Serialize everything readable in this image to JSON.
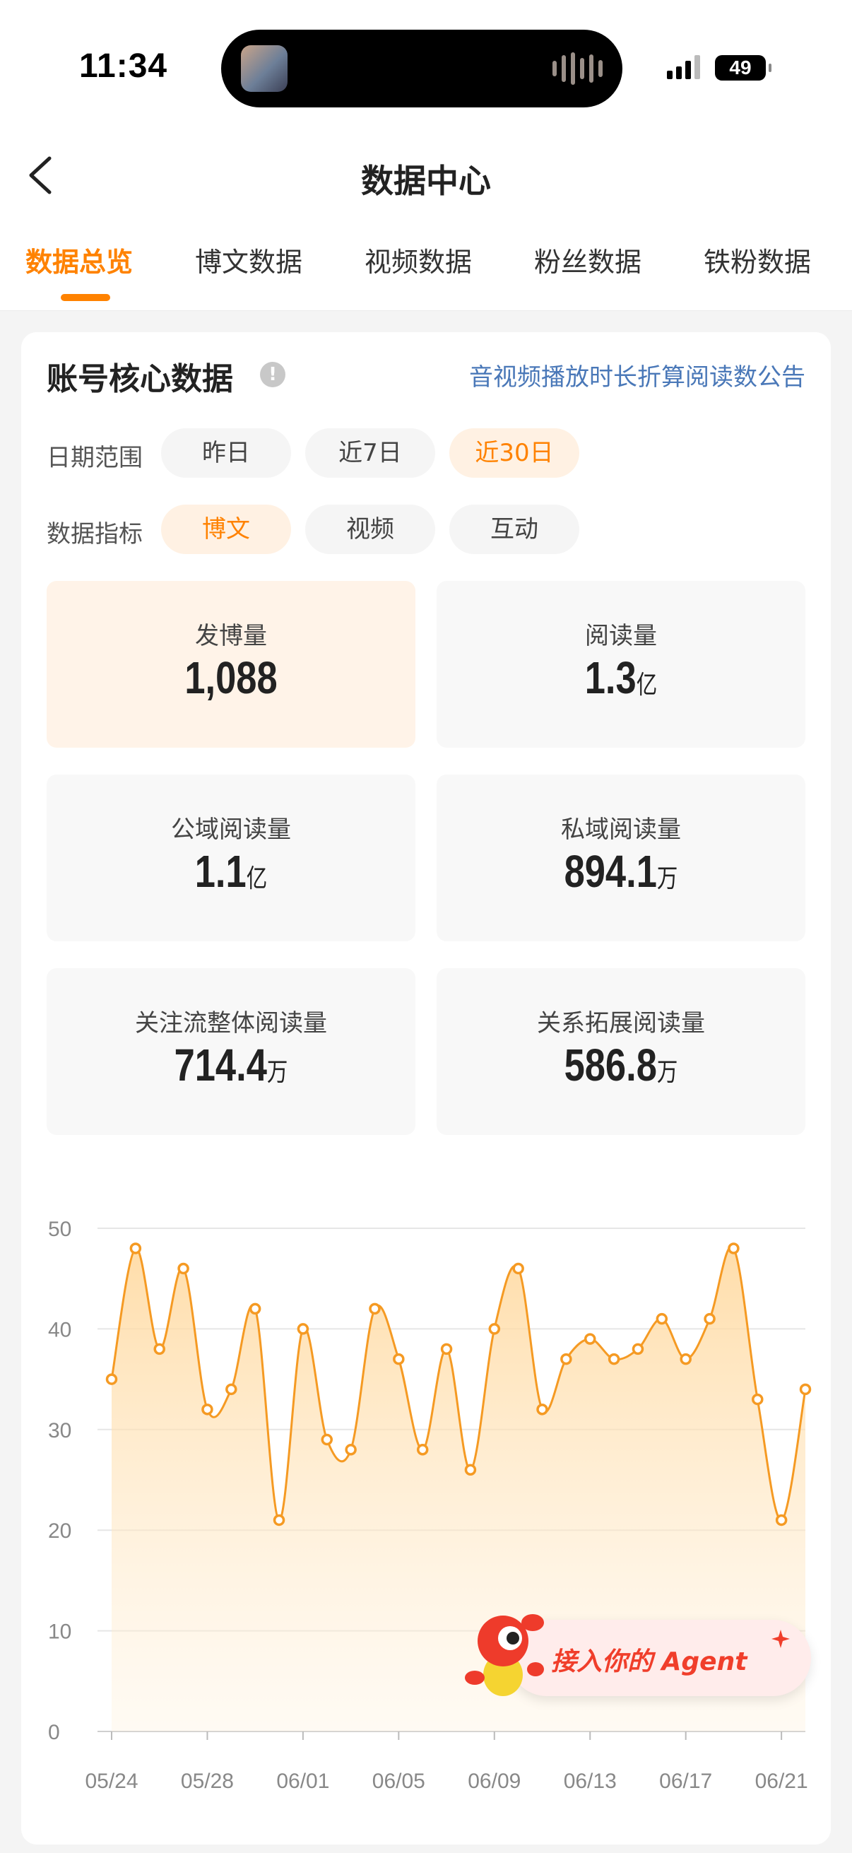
{
  "status_bar": {
    "time": "11:34",
    "battery": "49"
  },
  "header": {
    "title": "数据中心",
    "tabs": [
      "数据总览",
      "博文数据",
      "视频数据",
      "粉丝数据",
      "铁粉数据"
    ],
    "active_tab": 0
  },
  "card": {
    "title": "账号核心数据",
    "notice_link": "音视频播放时长折算阅读数公告",
    "date_range": {
      "label": "日期范围",
      "options": [
        "昨日",
        "近7日",
        "近30日"
      ],
      "active": 2
    },
    "metric": {
      "label": "数据指标",
      "options": [
        "博文",
        "视频",
        "互动"
      ],
      "active": 0
    },
    "stats": [
      {
        "label": "发博量",
        "value": "1,088",
        "unit": ""
      },
      {
        "label": "阅读量",
        "value": "1.3",
        "unit": "亿"
      },
      {
        "label": "公域阅读量",
        "value": "1.1",
        "unit": "亿"
      },
      {
        "label": "私域阅读量",
        "value": "894.1",
        "unit": "万"
      },
      {
        "label": "关注流整体阅读量",
        "value": "714.4",
        "unit": "万"
      },
      {
        "label": "关系拓展阅读量",
        "value": "586.8",
        "unit": "万"
      }
    ]
  },
  "agent_bubble": {
    "text": "接入你的 Agent"
  },
  "colors": {
    "accent": "#ff8200",
    "link": "#4a78b8",
    "agent_red": "#f03e2b"
  },
  "chart_data": {
    "type": "area",
    "x": [
      "05/24",
      "05/25",
      "05/26",
      "05/27",
      "05/28",
      "05/29",
      "05/30",
      "05/31",
      "06/01",
      "06/02",
      "06/03",
      "06/04",
      "06/05",
      "06/06",
      "06/07",
      "06/08",
      "06/09",
      "06/10",
      "06/11",
      "06/12",
      "06/13",
      "06/14",
      "06/15",
      "06/16",
      "06/17",
      "06/18",
      "06/19",
      "06/20",
      "06/21",
      "06/22"
    ],
    "series": [
      {
        "values": [
          35,
          48,
          38,
          46,
          32,
          34,
          42,
          21,
          40,
          29,
          28,
          42,
          37,
          28,
          38,
          26,
          40,
          46,
          32,
          37,
          39,
          37,
          38,
          41,
          37,
          41,
          48,
          33,
          21,
          34
        ]
      }
    ],
    "x_tick_labels": [
      "05/24",
      "05/28",
      "06/01",
      "06/05",
      "06/09",
      "06/13",
      "06/17",
      "06/21"
    ],
    "y_ticks": [
      0,
      10,
      20,
      30,
      40,
      50
    ],
    "ylim": [
      0,
      50
    ],
    "grid": true
  }
}
